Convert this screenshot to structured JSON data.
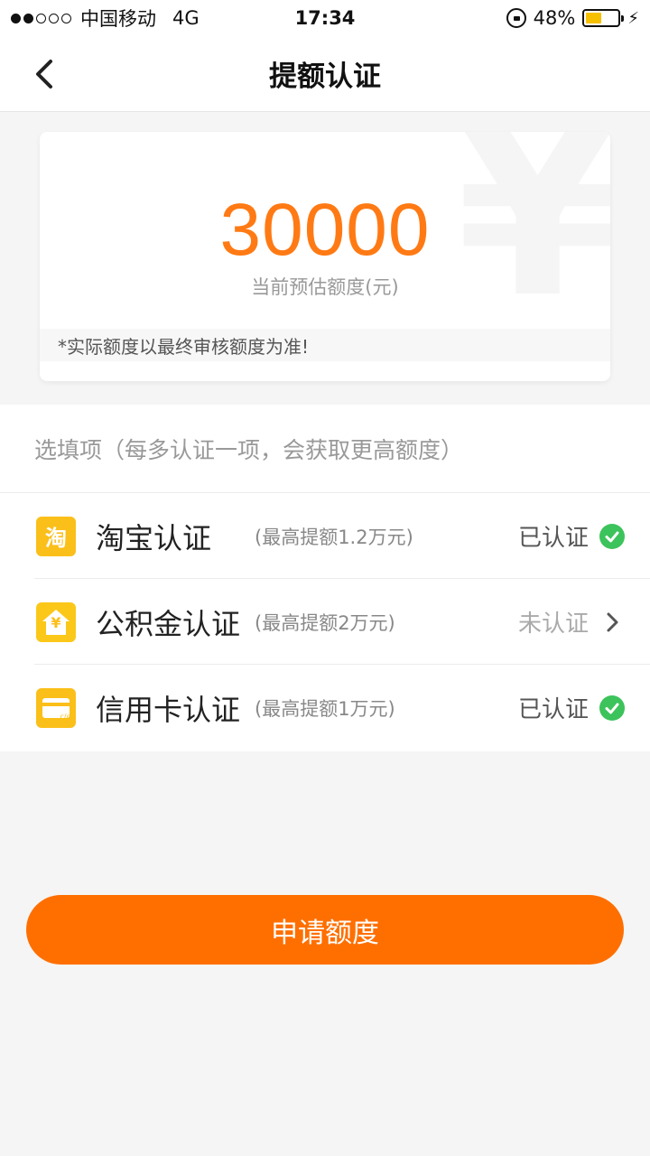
{
  "status_bar": {
    "carrier": "中国移动",
    "network": "4G",
    "time": "17:34",
    "battery": "48%",
    "battery_level": 0.48
  },
  "nav": {
    "title": "提额认证",
    "back_icon": "chevron-left-icon"
  },
  "quota": {
    "amount": "30000",
    "label": "当前预估额度(元)",
    "watermark": "¥",
    "disclaimer": "*实际额度以最终审核额度为准!"
  },
  "optional": {
    "header": "选填项（每多认证一项，会获取更高额度）",
    "items": [
      {
        "icon": "taobao-icon",
        "icon_glyph": "淘",
        "name": "淘宝认证",
        "limit": "(最高提额1.2万元)",
        "status": "已认证",
        "verified": true
      },
      {
        "icon": "housing-fund-icon",
        "icon_glyph": "¥",
        "name": "公积金认证",
        "limit": "(最高提额2万元)",
        "status": "未认证",
        "verified": false
      },
      {
        "icon": "credit-card-icon",
        "icon_glyph": "c/c",
        "name": "信用卡认证",
        "limit": "(最高提额1万元)",
        "status": "已认证",
        "verified": true
      }
    ]
  },
  "apply_button": "申请额度",
  "colors": {
    "accent": "#ff6f00",
    "amount": "#ff7a14",
    "icon_bg": "#fbbf1a",
    "check": "#3cc35b"
  }
}
